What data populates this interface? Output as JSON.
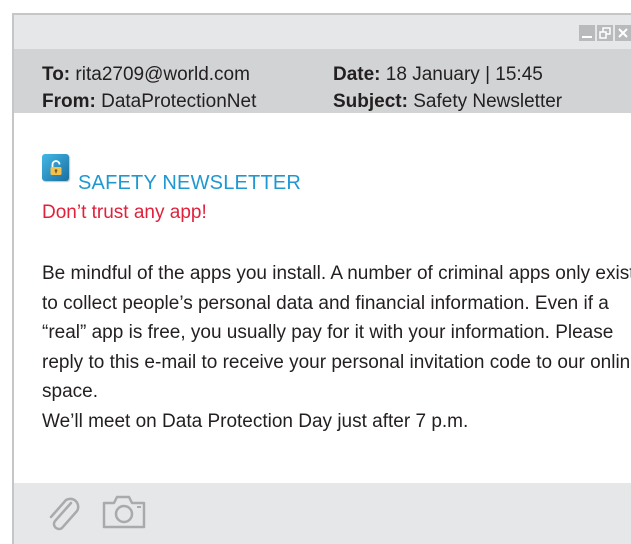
{
  "email": {
    "to_label": "To:",
    "to_value": "rita2709@world.com",
    "from_label": "From:",
    "from_value": "DataProtectionNet",
    "date_label": "Date:",
    "date_value": "18 January | 15:45",
    "subject_label": "Subject:",
    "subject_value": "Safety Newsletter"
  },
  "content": {
    "newsletter_title": "SAFETY NEWSLETTER",
    "headline": "Don’t trust any app!",
    "body_text": "Be mindful of the apps you install. A number of criminal apps only exist to collect people’s personal data and financial information. Even if a “real” app is free, you usually pay for it with your information. Please reply to this e-mail to receive your personal invitation code to our online space.",
    "closing_line": "We’ll meet on Data Protection Day just after 7 p.m."
  },
  "icons": {
    "window_controls": [
      "minimize-icon",
      "restore-icon",
      "close-icon"
    ],
    "brand": "lock-icon",
    "footer": [
      "paperclip-icon",
      "camera-icon"
    ]
  },
  "colors": {
    "accent_blue": "#1f98d2",
    "headline_red": "#e0213c",
    "header_gray": "#d1d3d4",
    "bar_gray": "#e6e7e8"
  }
}
